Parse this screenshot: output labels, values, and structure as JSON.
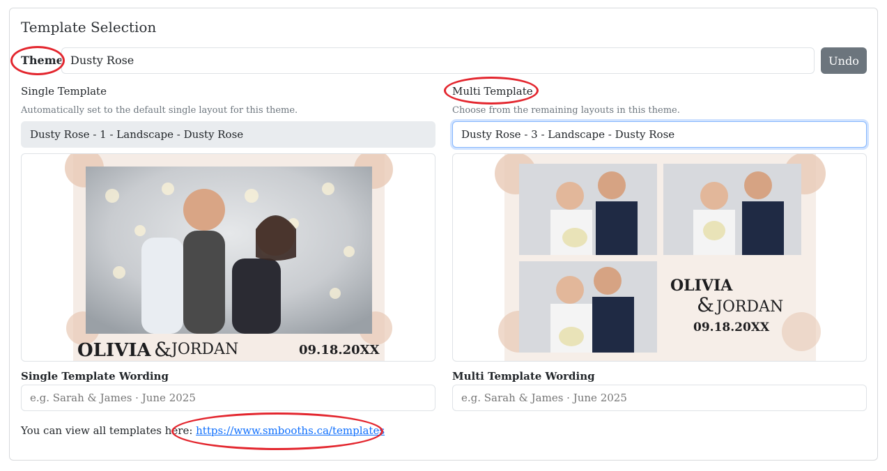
{
  "section": {
    "title": "Template Selection"
  },
  "theme": {
    "label": "Theme",
    "value": "Dusty Rose",
    "undo_label": "Undo"
  },
  "single": {
    "label": "Single Template",
    "help": "Automatically set to the default single layout for this theme.",
    "selected": "Dusty Rose - 1 - Landscape - Dusty Rose",
    "preview": {
      "name_left": "OLIVIA",
      "ampersand": "&",
      "name_right": "JORDAN",
      "date": "09.18.20XX"
    },
    "wording_label": "Single Template Wording",
    "wording_placeholder": "e.g. Sarah & James · June 2025"
  },
  "multi": {
    "label": "Multi Template",
    "help": "Choose from the remaining layouts in this theme.",
    "selected": "Dusty Rose - 3 - Landscape - Dusty Rose",
    "preview": {
      "name_left": "OLIVIA",
      "ampersand": "&",
      "name_right": "JORDAN",
      "date": "09.18.20XX"
    },
    "wording_label": "Multi Template Wording",
    "wording_placeholder": "e.g. Sarah & James · June 2025"
  },
  "footer": {
    "text": "You can view all templates here: ",
    "link": "https://www.smbooths.ca/templates"
  },
  "colors": {
    "accent": "#0d6efd",
    "undo_bg": "#6c757d",
    "annotation": "#e3262e",
    "floral": "#e8c9b5"
  }
}
